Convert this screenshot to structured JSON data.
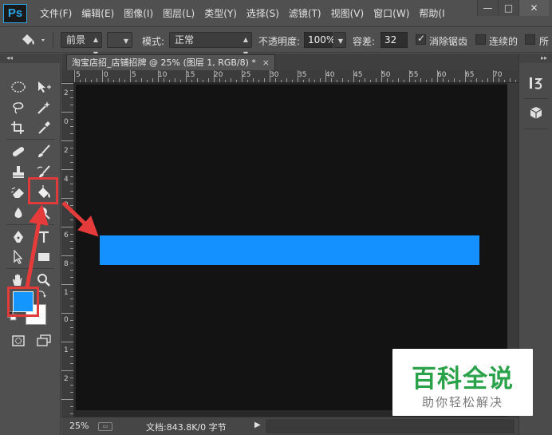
{
  "app": {
    "logo": "Ps",
    "menu": [
      "文件(F)",
      "编辑(E)",
      "图像(I)",
      "图层(L)",
      "类型(Y)",
      "选择(S)",
      "滤镜(T)",
      "视图(V)",
      "窗口(W)",
      "帮助(I"
    ],
    "window_controls": [
      "—",
      "□",
      "✕"
    ]
  },
  "options_bar": {
    "fill_source": "前景",
    "mode_label": "模式:",
    "mode_value": "正常",
    "opacity_label": "不透明度:",
    "opacity_value": "100%",
    "tolerance_label": "容差:",
    "tolerance_value": "32",
    "antialias_label": "消除锯齿",
    "antialias_checked": true,
    "contiguous_label": "连续的",
    "contiguous_checked": false,
    "all_layers_label": "所",
    "all_layers_checked": false
  },
  "panels": {
    "collapse_left": "◂◂",
    "collapse_right": "▸▸"
  },
  "document": {
    "tab_title": "淘宝店招_店铺招牌 @ 25% (图层 1, RGB/8) *",
    "tab_close": "×",
    "banner_color": "#1590ff",
    "canvas_color": "#131313"
  },
  "rulers": {
    "top": [
      "5",
      "0",
      "5",
      "10",
      "15",
      "20",
      "25",
      "30",
      "35",
      "40",
      "45",
      "50",
      "55",
      "60",
      "65",
      "70"
    ],
    "left": [
      "2",
      "0",
      "2",
      "4",
      "0",
      "6",
      "8",
      "1",
      "0",
      "1",
      "2"
    ]
  },
  "colors": {
    "foreground": "#1496ff",
    "background": "#ffffff",
    "highlight": "#e03a3a"
  },
  "status": {
    "zoom": "25%",
    "doc_info": "文档:843.8K/0 字节",
    "arrow": "▶"
  },
  "watermark": {
    "title": "百科全说",
    "subtitle": "助你轻松解决"
  }
}
